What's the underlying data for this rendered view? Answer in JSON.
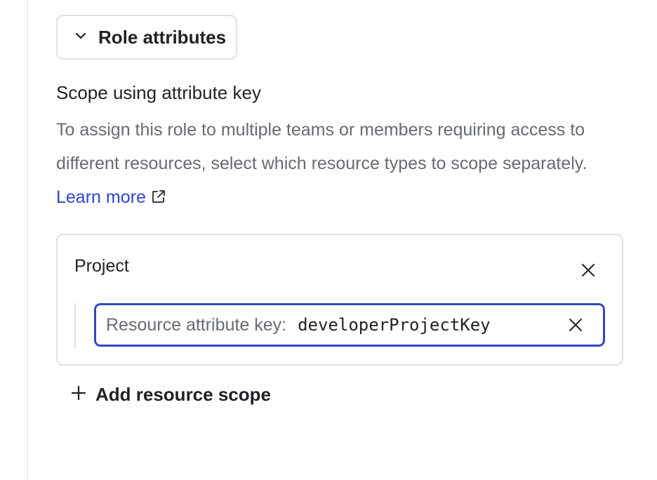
{
  "role_attributes": {
    "toggle_label": "Role attributes",
    "toggle_icon": "chevron-down-icon"
  },
  "scope": {
    "heading": "Scope using attribute key",
    "description": "To assign this role to multiple teams or members requiring access to different resources, select which resource types to scope separately.",
    "learn_more_label": "Learn more",
    "link_color": "#2e45d0"
  },
  "resource_card": {
    "title": "Project",
    "field_label": "Resource attribute key:",
    "field_value": "developerProjectKey",
    "field_border_color": "#3446c9"
  },
  "add_scope": {
    "label": "Add resource scope",
    "icon": "plus-icon"
  }
}
